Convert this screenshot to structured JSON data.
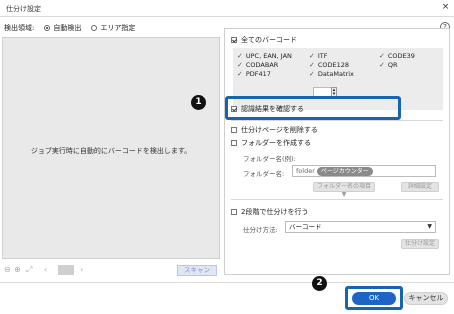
{
  "window": {
    "title": "仕分け設定",
    "close_glyph": "×"
  },
  "detection": {
    "label": "検出領域:",
    "options": [
      {
        "label": "自動検出",
        "selected": true
      },
      {
        "label": "エリア指定",
        "selected": false
      }
    ]
  },
  "preview": {
    "message": "ジョブ実行時に自動的にバーコードを検出します。"
  },
  "zoom": {
    "scan_label": "スキャン"
  },
  "barcodes": {
    "all_label": "全てのバーコード",
    "all_checked": true,
    "col1": [
      "UPC, EAN, JAN",
      "CODABAR",
      "PDF417"
    ],
    "col2": [
      "ITF",
      "CODE128",
      "DataMatrix"
    ],
    "col3": [
      "CODE39",
      "QR"
    ]
  },
  "options": {
    "confirm_label": "認識結果を確認する",
    "confirm_checked": true,
    "delete_label": "仕分けページを削除する",
    "delete_checked": false,
    "create_folder_label": "フォルダーを作成する",
    "create_folder_checked": false
  },
  "folder": {
    "name_example_label": "フォルダー名(例):",
    "name_label": "フォルダー名:",
    "name_value": "folder",
    "name_token": "ページカウンター",
    "item_button": "フォルダー名の項目 ▼",
    "detail_button": "詳細設定"
  },
  "two_step": {
    "label": "2段階で仕分けを行う",
    "checked": false,
    "method_label": "仕分け方法:",
    "method_value": "バーコード",
    "settings_button": "仕分け設定"
  },
  "footer": {
    "ok_label": "OK",
    "cancel_label": "キャンセル"
  },
  "callouts": {
    "one": "1",
    "two": "2"
  },
  "colors": {
    "accent": "#1e63c6",
    "callout": "#1565b0"
  }
}
